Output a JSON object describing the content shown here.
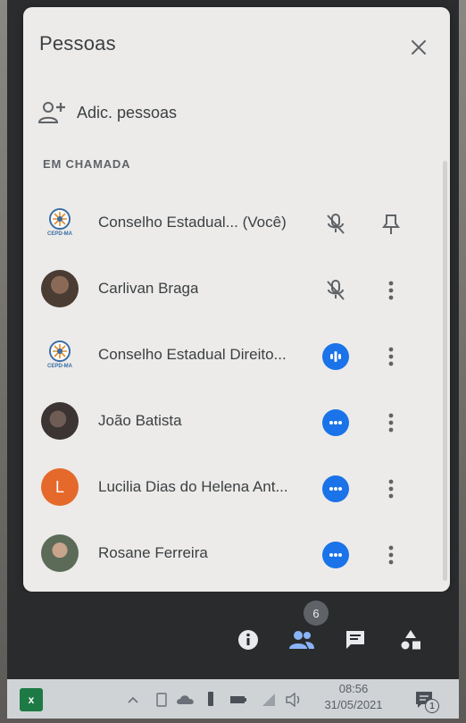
{
  "panel": {
    "title": "Pessoas",
    "add_people_label": "Adic. pessoas",
    "section_label": "EM CHAMADA"
  },
  "participants": [
    {
      "name": "Conselho Estadual... (Você)",
      "avatar": "cepd-logo",
      "status": "mic-off-icon",
      "action": "pin-icon"
    },
    {
      "name": "Carlivan Braga",
      "avatar": "photo",
      "status": "mic-off-icon",
      "action": "more-vert-icon"
    },
    {
      "name": "Conselho Estadual Direito...",
      "avatar": "cepd-logo",
      "status": "speaking-icon",
      "action": "more-vert-icon"
    },
    {
      "name": "João Batista",
      "avatar": "photo",
      "status": "more-horiz-icon",
      "action": "more-vert-icon"
    },
    {
      "name": "Lucilia Dias do Helena Ant...",
      "avatar": "letter",
      "avatar_letter": "L",
      "status": "more-horiz-icon",
      "action": "more-vert-icon"
    },
    {
      "name": "Rosane Ferreira",
      "avatar": "photo",
      "status": "more-horiz-icon",
      "action": "more-vert-icon"
    }
  ],
  "logo_text": "CEPD-MA",
  "bottom_bar": {
    "people_count": "6",
    "icons": [
      "info-icon",
      "people-icon",
      "chat-icon",
      "activities-icon"
    ]
  },
  "taskbar": {
    "time": "08:56",
    "date": "31/05/2021",
    "notification_count": "1"
  },
  "colors": {
    "accent": "#1a73e8",
    "panel_bg": "#ecebe9",
    "letter_avatar": "#e5692a",
    "bottom_bar_bg": "#2a2b2d"
  }
}
